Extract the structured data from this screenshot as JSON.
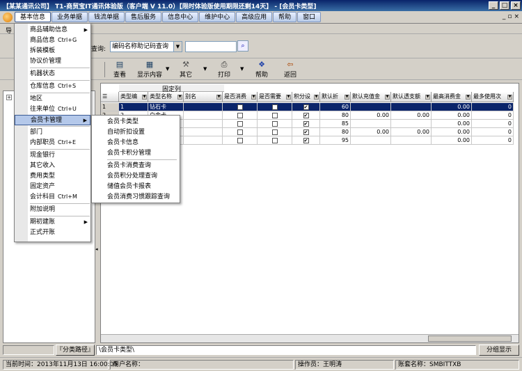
{
  "window": {
    "title": "【某某通讯公司】 T1-商贸宝IT通讯体验版（客户端 V 11.0）【限时体验版使用期限还剩14天】 - [会员卡类型]"
  },
  "menubar": {
    "items": [
      "基本信息",
      "业务单据",
      "钱流单据",
      "售后服务",
      "信息中心",
      "维护中心",
      "高级应用",
      "帮助",
      "窗口"
    ]
  },
  "strip2": {
    "label": "导"
  },
  "query": {
    "label": "查询:",
    "mode": "编码名称助记码查询",
    "value": ""
  },
  "toolbar": {
    "view": "查看",
    "display": "显示内容",
    "other": "其它",
    "print": "打印",
    "help": "帮助",
    "back": "返回"
  },
  "dropdown": {
    "items": [
      {
        "label": "商品辅助信息",
        "shortcut": "",
        "submenu": true
      },
      {
        "label": "商品信息",
        "shortcut": "Ctrl+G",
        "submenu": false
      },
      {
        "label": "拆装模板",
        "shortcut": "",
        "submenu": false
      },
      {
        "label": "协议价管理",
        "shortcut": "",
        "submenu": false
      },
      {
        "label": "机器状态",
        "shortcut": "",
        "submenu": false
      },
      {
        "label": "仓库信息",
        "shortcut": "Ctrl+S",
        "submenu": false
      },
      {
        "label": "地区",
        "shortcut": "",
        "submenu": false
      },
      {
        "label": "往来单位",
        "shortcut": "Ctrl+U",
        "submenu": false
      },
      {
        "label": "会员卡管理",
        "shortcut": "",
        "submenu": true
      },
      {
        "label": "部门",
        "shortcut": "",
        "submenu": false
      },
      {
        "label": "内部职员",
        "shortcut": "Ctrl+E",
        "submenu": false
      },
      {
        "label": "现金银行",
        "shortcut": "",
        "submenu": false
      },
      {
        "label": "其它收入",
        "shortcut": "",
        "submenu": false
      },
      {
        "label": "费用类型",
        "shortcut": "",
        "submenu": false
      },
      {
        "label": "固定资产",
        "shortcut": "",
        "submenu": false
      },
      {
        "label": "会计科目",
        "shortcut": "Ctrl+M",
        "submenu": false
      },
      {
        "label": "附加说明",
        "shortcut": "",
        "submenu": false
      },
      {
        "label": "期初建账",
        "shortcut": "",
        "submenu": true
      },
      {
        "label": "正式开账",
        "shortcut": "",
        "submenu": false
      }
    ]
  },
  "submenu": {
    "items": [
      "会员卡类型",
      "自动折扣设置",
      "会员卡信息",
      "会员卡积分管理",
      "会员卡消费查询",
      "会员积分处理查询",
      "储值会员卡报表",
      "会员消费习惯跟踪查询"
    ]
  },
  "grid": {
    "fixed_header": "固定列",
    "columns": [
      "类型编",
      "类型名称",
      "别名",
      "是否消费",
      "是否需要",
      "积分设",
      "默认折",
      "默认充值金",
      "默认透支额",
      "最高消费金",
      "最多使用次"
    ],
    "rows": [
      {
        "no": "1",
        "code": "1",
        "name": "钻石卡",
        "alias": "",
        "consume": false,
        "need": false,
        "points": true,
        "discount": "60",
        "recharge": "",
        "overdraft": "",
        "maxspend": "0.00",
        "maxuse": "0"
      },
      {
        "no": "2",
        "code": "2",
        "name": "白金卡",
        "alias": "",
        "consume": false,
        "need": false,
        "points": true,
        "discount": "80",
        "recharge": "0.00",
        "overdraft": "0.00",
        "maxspend": "0.00",
        "maxuse": "0"
      },
      {
        "no": "3",
        "code": "",
        "name": "",
        "alias": "",
        "consume": false,
        "need": false,
        "points": true,
        "discount": "85",
        "recharge": "",
        "overdraft": "",
        "maxspend": "0.00",
        "maxuse": "0"
      },
      {
        "no": "4",
        "code": "",
        "name": "",
        "alias": "",
        "consume": false,
        "need": false,
        "points": true,
        "discount": "80",
        "recharge": "0.00",
        "overdraft": "0.00",
        "maxspend": "0.00",
        "maxuse": "0"
      },
      {
        "no": "5",
        "code": "",
        "name": "",
        "alias": "",
        "consume": false,
        "need": false,
        "points": true,
        "discount": "95",
        "recharge": "",
        "overdraft": "",
        "maxspend": "0.00",
        "maxuse": "0"
      }
    ]
  },
  "pathbar": {
    "category_path": "『分类路径』",
    "path": "\\会员卡类型\\",
    "toggle": "分组显示"
  },
  "status": {
    "time": "当前时间：2013年11月13日 16:00:05",
    "user": "用户名称：",
    "operator": "操作员：王明涛",
    "account": "账套名称：SMBITTXB"
  }
}
